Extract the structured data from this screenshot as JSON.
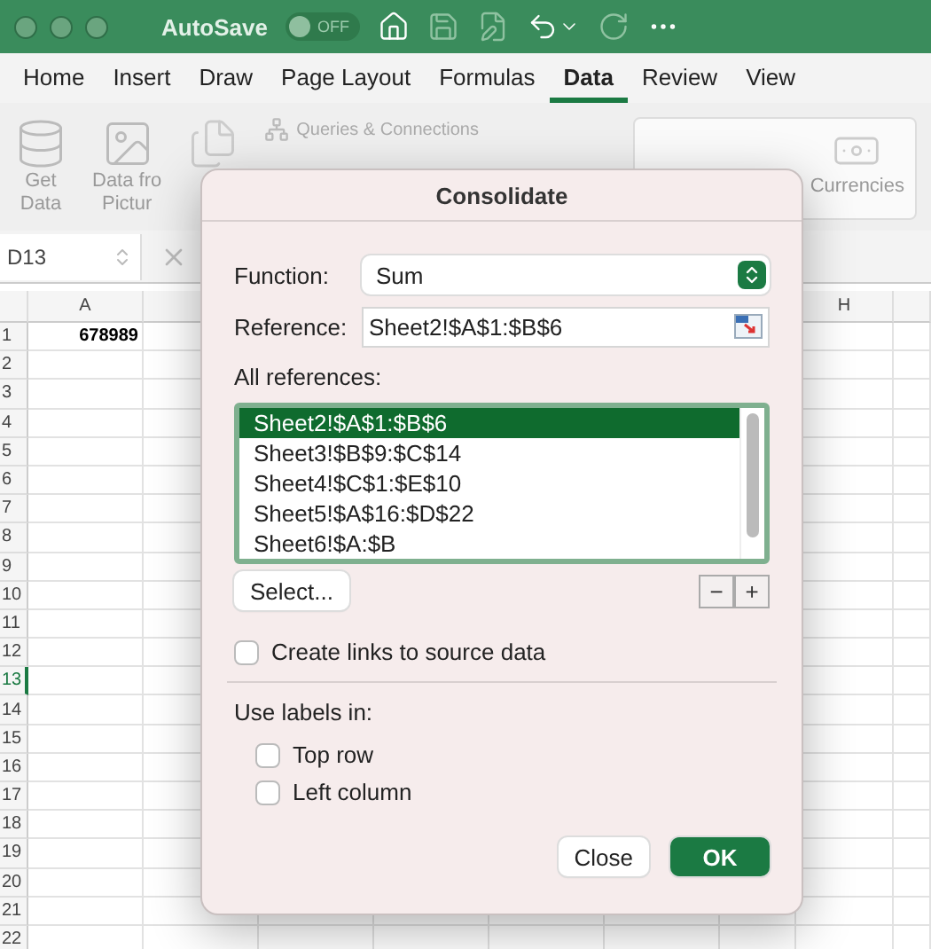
{
  "titlebar": {
    "autosave_label": "AutoSave",
    "autosave_toggle": {
      "label": "OFF",
      "on": false
    }
  },
  "tabs": [
    {
      "label": "Home",
      "selected": false
    },
    {
      "label": "Insert",
      "selected": false
    },
    {
      "label": "Draw",
      "selected": false
    },
    {
      "label": "Page Layout",
      "selected": false
    },
    {
      "label": "Formulas",
      "selected": false
    },
    {
      "label": "Data",
      "selected": true
    },
    {
      "label": "Review",
      "selected": false
    },
    {
      "label": "View",
      "selected": false
    }
  ],
  "ribbon": {
    "get_data": [
      "Get",
      "Data"
    ],
    "data_from_picture": [
      "Data fro",
      "Pictur"
    ],
    "queries": "Queries & Connections",
    "currencies": "Currencies"
  },
  "name_box": "D13",
  "sheet": {
    "columns": [
      {
        "label": "A"
      },
      {
        "label": "H"
      }
    ],
    "rows": [
      {
        "number": "1",
        "selected": false,
        "value": "678989"
      },
      {
        "number": "2",
        "selected": false
      },
      {
        "number": "3",
        "selected": false
      },
      {
        "number": "4",
        "selected": false
      },
      {
        "number": "5",
        "selected": false
      },
      {
        "number": "6",
        "selected": false
      },
      {
        "number": "7",
        "selected": false
      },
      {
        "number": "8",
        "selected": false
      },
      {
        "number": "9",
        "selected": false
      },
      {
        "number": "10",
        "selected": false
      },
      {
        "number": "11",
        "selected": false
      },
      {
        "number": "12",
        "selected": false
      },
      {
        "number": "13",
        "selected": true
      },
      {
        "number": "14",
        "selected": false
      },
      {
        "number": "15",
        "selected": false
      },
      {
        "number": "16",
        "selected": false
      },
      {
        "number": "17",
        "selected": false
      },
      {
        "number": "18",
        "selected": false
      },
      {
        "number": "19",
        "selected": false
      },
      {
        "number": "20",
        "selected": false
      },
      {
        "number": "21",
        "selected": false
      },
      {
        "number": "22",
        "selected": false
      }
    ]
  },
  "dialog": {
    "title": "Consolidate",
    "function_label": "Function:",
    "function_value": "Sum",
    "reference_label": "Reference:",
    "reference_value": "Sheet2!$A$1:$B$6",
    "all_references_label": "All references:",
    "references": [
      {
        "text": "Sheet2!$A$1:$B$6",
        "selected": true
      },
      {
        "text": "Sheet3!$B$9:$C$14",
        "selected": false
      },
      {
        "text": "Sheet4!$C$1:$E$10",
        "selected": false
      },
      {
        "text": "Sheet5!$A$16:$D$22",
        "selected": false
      },
      {
        "text": "Sheet6!$A:$B",
        "selected": false
      }
    ],
    "select_button": "Select...",
    "remove_button": "−",
    "add_button": "+",
    "create_links": {
      "label": "Create links to source data",
      "checked": false
    },
    "use_labels_label": "Use labels in:",
    "label_options": [
      {
        "label": "Top row",
        "checked": false
      },
      {
        "label": "Left column",
        "checked": false
      }
    ],
    "buttons": [
      {
        "label": "Close",
        "kind": "secondary"
      },
      {
        "label": "OK",
        "kind": "primary"
      }
    ]
  }
}
